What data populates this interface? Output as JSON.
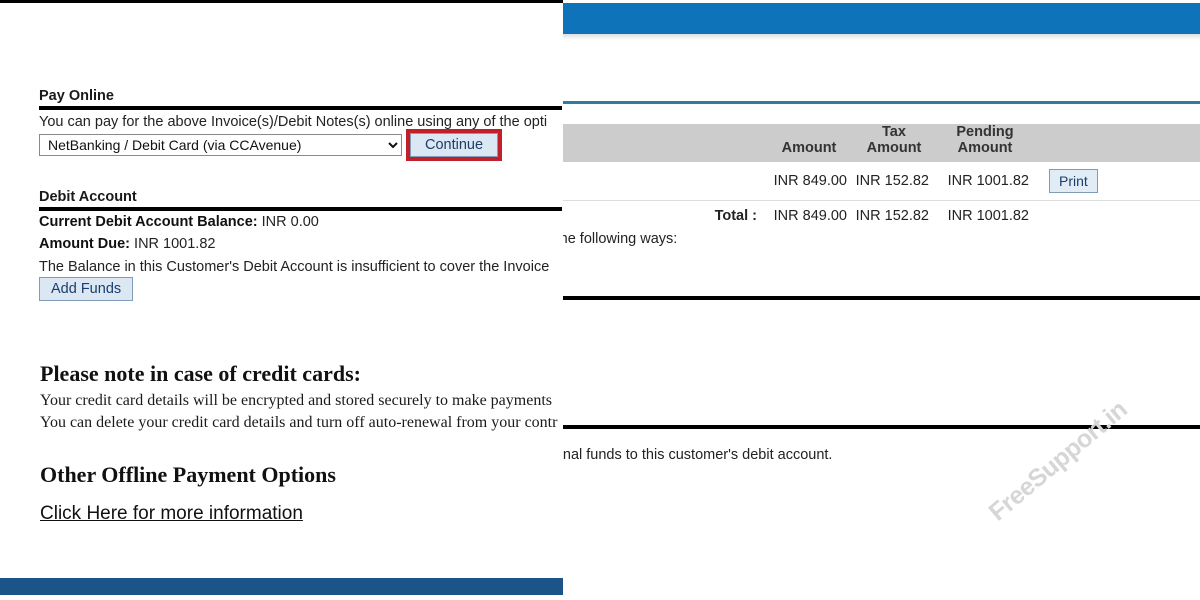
{
  "background_page": {
    "topbar_color": "#0e73b8",
    "rule_color": "#2e7d9a",
    "invoice_table": {
      "headers": {
        "description": "",
        "amount": "Amount",
        "tax_amount_line1": "Tax",
        "tax_amount_line2": "Amount",
        "pending_amount_line1": "Pending",
        "pending_amount_line2": "Amount",
        "actions": ""
      },
      "header_bg": "#cccccc",
      "rows": [
        {
          "description": "",
          "amount": "INR 849.00",
          "tax_amount": "INR 152.82",
          "pending_amount": "INR 1001.82",
          "action_label": "Print"
        }
      ],
      "total": {
        "label": "Total :",
        "amount": "INR 849.00",
        "tax_amount": "INR 152.82",
        "pending_amount": "INR 1001.82"
      }
    },
    "fragments": {
      "ways_text": "n any of the following ways:",
      "small_fragment": "e",
      "funds_text": "dd additional funds to this customer's debit account."
    },
    "watermark": "FreeSupport.in"
  },
  "foreground_panel": {
    "bottombar_color": "#1a5488",
    "pay_online": {
      "title": "Pay Online",
      "description": "You can pay for the above Invoice(s)/Debit Notes(s) online using any of the opti",
      "selected_method": "NetBanking / Debit Card (via CCAvenue)",
      "method_options": [
        "NetBanking / Debit Card (via CCAvenue)"
      ],
      "continue_label": "Continue",
      "highlight_color": "#c0202a"
    },
    "debit_account": {
      "title": "Debit Account",
      "balance_label": "Current Debit Account Balance:",
      "balance_value": "INR 0.00",
      "amount_due_label": "Amount Due:",
      "amount_due_value": "INR 1001.82",
      "insufficient_notice": "The Balance in this Customer's Debit Account is insufficient to cover the Invoice",
      "add_funds_label": "Add Funds"
    },
    "credit_card_note": {
      "heading": "Please note in case of credit cards:",
      "line1": "Your credit card details will be encrypted and stored securely to make payments",
      "line2": "You can delete your credit card details and turn off auto-renewal from your contr"
    },
    "offline_payment": {
      "title": "Other Offline Payment Options",
      "link_label": "Click Here for more information"
    }
  }
}
